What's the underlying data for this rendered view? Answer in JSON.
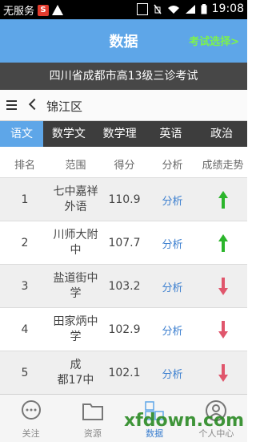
{
  "status_bar": {
    "carrier": "无服务",
    "time": "19:08"
  },
  "header": {
    "title": "数据",
    "exam_select": "考试选择>"
  },
  "exam_title": "四川省成都市高13级三诊考试",
  "region": {
    "label": "锦江区"
  },
  "tabs": [
    {
      "label": "语文",
      "active": true
    },
    {
      "label": "数学文",
      "active": false
    },
    {
      "label": "数学理",
      "active": false
    },
    {
      "label": "英语",
      "active": false
    },
    {
      "label": "政治",
      "active": false
    }
  ],
  "table": {
    "headers": [
      "排名",
      "范围",
      "得分",
      "分析",
      "成绩走势"
    ],
    "rows": [
      {
        "rank": "1",
        "school_line1": "七中嘉祥",
        "school_line2": "外语",
        "score": "110.9",
        "analysis": "分析",
        "trend": "up"
      },
      {
        "rank": "2",
        "school_line1": "川师大附",
        "school_line2": "中",
        "score": "107.7",
        "analysis": "分析",
        "trend": "up"
      },
      {
        "rank": "3",
        "school_line1": "盐道街中",
        "school_line2": "学",
        "score": "103.2",
        "analysis": "分析",
        "trend": "down"
      },
      {
        "rank": "4",
        "school_line1": "田家炳中",
        "school_line2": "学",
        "score": "102.9",
        "analysis": "分析",
        "trend": "down"
      },
      {
        "rank": "5",
        "school_line1": "成",
        "school_line2": "都17中",
        "score": "102.1",
        "analysis": "分析",
        "trend": "down"
      }
    ]
  },
  "bottom_nav": [
    {
      "label": "关注",
      "icon": "chat-bubble-icon",
      "active": false
    },
    {
      "label": "资源",
      "icon": "folder-icon",
      "active": false
    },
    {
      "label": "数据",
      "icon": "grid-icon",
      "active": true
    },
    {
      "label": "个人中心",
      "icon": "user-icon",
      "active": false
    }
  ],
  "watermark": "xfdown.com",
  "colors": {
    "accent": "#5ea6e8",
    "exam_select": "#7cf24e",
    "up": "#2bb52b",
    "down": "#e0566c",
    "link": "#3c7fcf"
  }
}
